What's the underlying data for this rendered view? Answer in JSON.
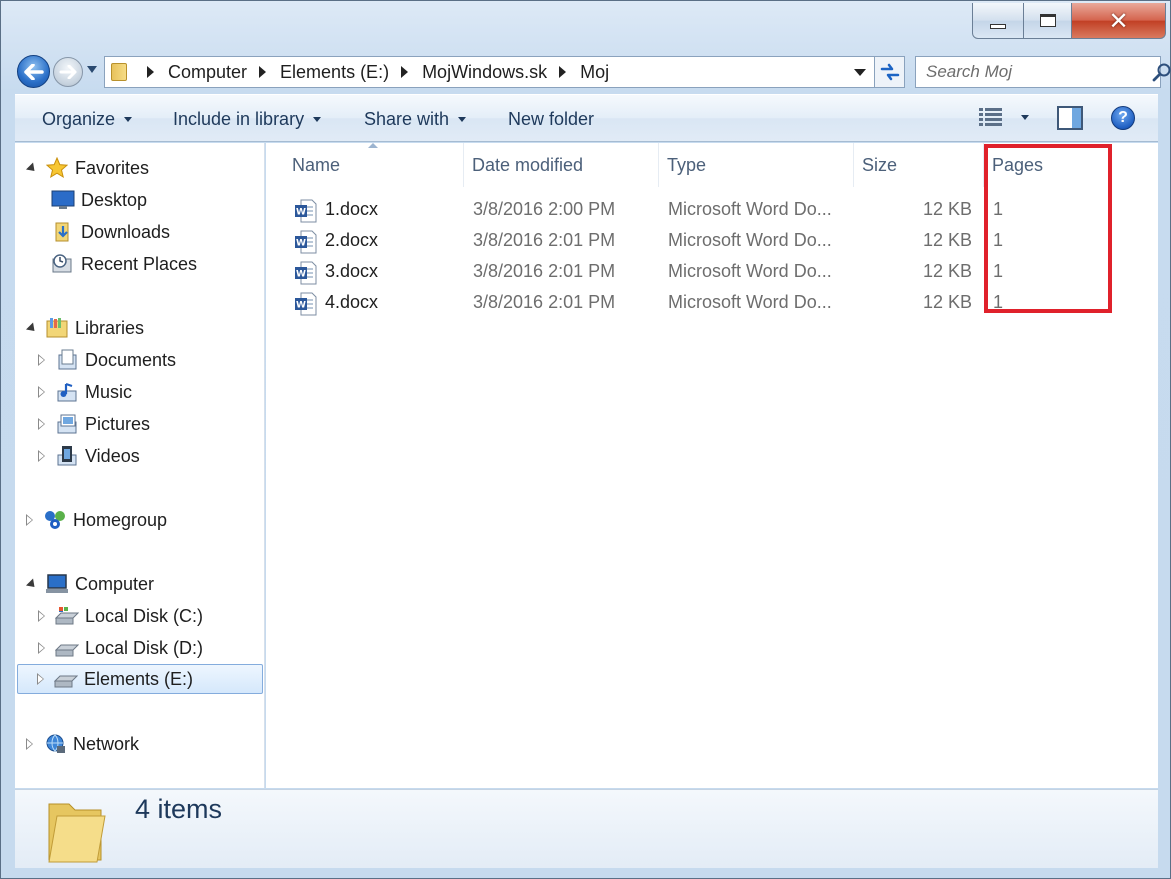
{
  "window": {
    "caption": {
      "minimize": "minimize",
      "maximize": "maximize",
      "close": "close"
    }
  },
  "navbar": {
    "breadcrumbs": [
      "Computer",
      "Elements (E:)",
      "MojWindows.sk",
      "Moj"
    ],
    "search_placeholder": "Search Moj"
  },
  "toolbar": {
    "organize": "Organize",
    "include_in_library": "Include in library",
    "share_with": "Share with",
    "new_folder": "New folder"
  },
  "navpane": {
    "favorites": "Favorites",
    "favorites_items": [
      "Desktop",
      "Downloads",
      "Recent Places"
    ],
    "libraries": "Libraries",
    "libraries_items": [
      "Documents",
      "Music",
      "Pictures",
      "Videos"
    ],
    "homegroup": "Homegroup",
    "computer": "Computer",
    "computer_items": [
      "Local Disk (C:)",
      "Local Disk (D:)",
      "Elements (E:)"
    ],
    "network": "Network"
  },
  "columns": [
    "Name",
    "Date modified",
    "Type",
    "Size",
    "Pages"
  ],
  "files": [
    {
      "name": "1.docx",
      "date": "3/8/2016 2:00 PM",
      "type": "Microsoft Word Do...",
      "size": "12 KB",
      "pages": "1"
    },
    {
      "name": "2.docx",
      "date": "3/8/2016 2:01 PM",
      "type": "Microsoft Word Do...",
      "size": "12 KB",
      "pages": "1"
    },
    {
      "name": "3.docx",
      "date": "3/8/2016 2:01 PM",
      "type": "Microsoft Word Do...",
      "size": "12 KB",
      "pages": "1"
    },
    {
      "name": "4.docx",
      "date": "3/8/2016 2:01 PM",
      "type": "Microsoft Word Do...",
      "size": "12 KB",
      "pages": "1"
    }
  ],
  "details": {
    "item_count": "4 items"
  },
  "colors": {
    "highlight": "#e0212b",
    "accent": "#1e395b"
  }
}
